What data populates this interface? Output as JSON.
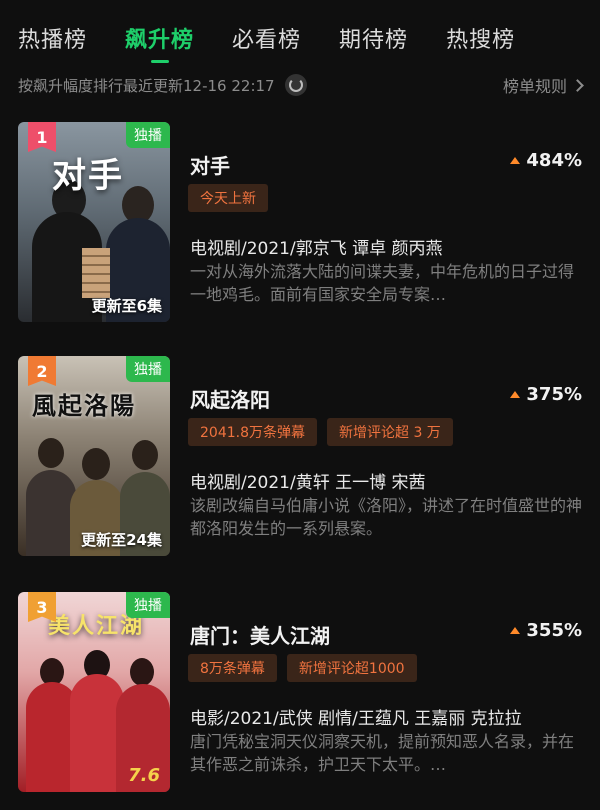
{
  "tabs": [
    {
      "label": "热播榜",
      "active": false
    },
    {
      "label": "飙升榜",
      "active": true
    },
    {
      "label": "必看榜",
      "active": false
    },
    {
      "label": "期待榜",
      "active": false
    },
    {
      "label": "热搜榜",
      "active": false
    }
  ],
  "subheader": {
    "text": "按飙升幅度排行最近更新12-16 22:17",
    "rules_label": "榜单规则"
  },
  "colors": {
    "accent": "#1ecf6a",
    "tag_text": "#f0733f",
    "tag_bg": "#3a2519",
    "exclusive": "#2db84d"
  },
  "items": [
    {
      "rank": "1",
      "rank_color": "#ee4f6a",
      "badge": "独播",
      "poster_title": "对手",
      "poster_footer": "更新至6集",
      "title": "对手",
      "growth": "484%",
      "tags": [
        "今天上新"
      ],
      "meta": "电视剧/2021/郭京飞 谭卓 颜丙燕",
      "desc": "一对从海外流落大陆的间谍夫妻，中年危机的日子过得一地鸡毛。面前有国家安全局专案…"
    },
    {
      "rank": "2",
      "rank_color": "#f07a33",
      "badge": "独播",
      "poster_title": "風起洛陽",
      "poster_footer": "更新至24集",
      "title": "风起洛阳",
      "growth": "375%",
      "tags": [
        "2041.8万条弹幕",
        "新增评论超 3 万"
      ],
      "meta": "电视剧/2021/黄轩 王一博 宋茜",
      "desc": "该剧改编自马伯庸小说《洛阳》，讲述了在时值盛世的神都洛阳发生的一系列悬案。"
    },
    {
      "rank": "3",
      "rank_color": "#f0a033",
      "badge": "独播",
      "poster_title": "美人江湖",
      "poster_footer": "7.6",
      "title": "唐门：美人江湖",
      "growth": "355%",
      "tags": [
        "8万条弹幕",
        "新增评论超1000"
      ],
      "meta": "电影/2021/武侠 剧情/王蕴凡 王嘉丽 克拉拉",
      "desc": "唐门凭秘宝洞天仪洞察天机，提前预知恶人名录，并在其作恶之前诛杀，护卫天下太平。…"
    }
  ]
}
